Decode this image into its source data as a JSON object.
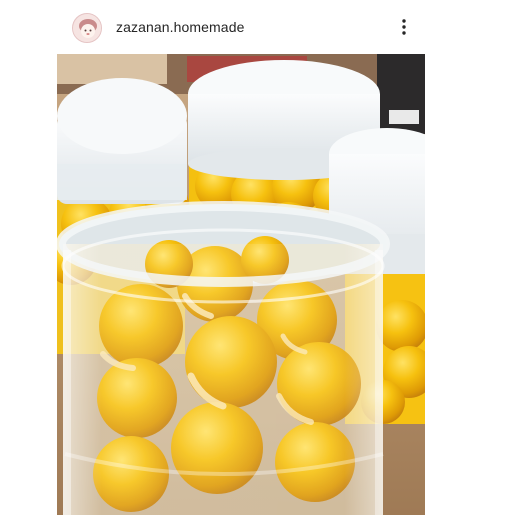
{
  "post": {
    "username": "zazanan.homemade",
    "avatar_icon": "user-avatar-icon",
    "more_icon": "more-options-icon"
  },
  "colors": {
    "header_bg": "#ffffff",
    "username_text": "#262626",
    "ball_yellow": "#f2b80f",
    "ball_shade": "#d99606",
    "ball_cream": "#fbe7b3",
    "jar_lid": "#eef2f4",
    "table_wood": "#b48e66"
  }
}
